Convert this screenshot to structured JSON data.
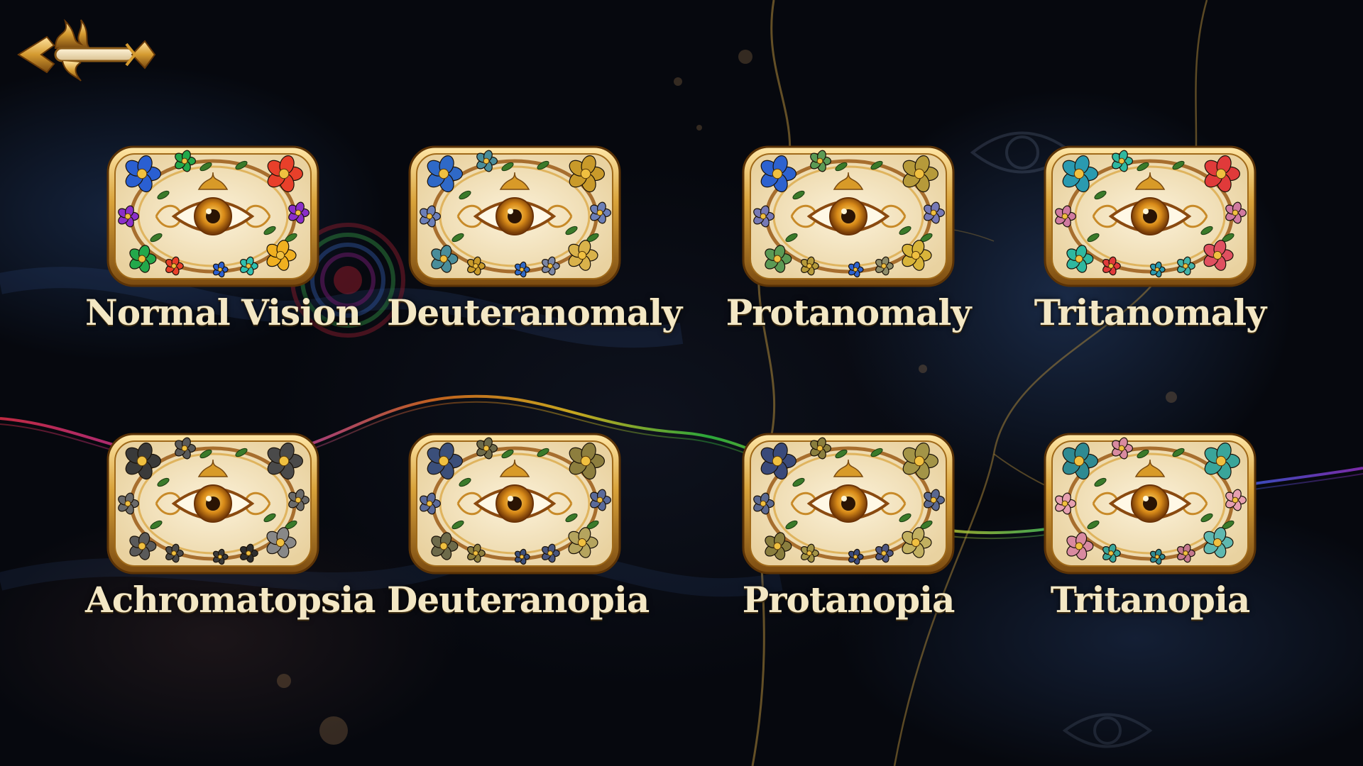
{
  "screen": {
    "title": "",
    "back_button": {
      "icon": "ornate-back-arrow-icon"
    }
  },
  "vision_modes": [
    {
      "id": "normal-vision",
      "label": "Normal Vision",
      "flower_colors": [
        "#2a5fd1",
        "#23a84b",
        "#e8402a",
        "#8b2fc9",
        "#f0b020",
        "#2fc0b0"
      ]
    },
    {
      "id": "deuteranomaly",
      "label": "Deuteranomaly",
      "flower_colors": [
        "#2f69c7",
        "#4a8d9a",
        "#c99a2a",
        "#6c7fb8",
        "#d9b24a",
        "#7b86a4"
      ]
    },
    {
      "id": "protanomaly",
      "label": "Protanomaly",
      "flower_colors": [
        "#2d62cf",
        "#5b9a55",
        "#b69a3a",
        "#7679b6",
        "#d8b43a",
        "#8e8c6a"
      ]
    },
    {
      "id": "tritanomaly",
      "label": "Tritanomaly",
      "flower_colors": [
        "#2a9ab0",
        "#2fb8a0",
        "#e03a3a",
        "#d07aa0",
        "#e05060",
        "#43b3a8"
      ]
    },
    {
      "id": "achromatopsia",
      "label": "Achromatopsia",
      "flower_colors": [
        "#3a3a3a",
        "#5a5a5a",
        "#4a4a4a",
        "#6a6a6a",
        "#888888",
        "#2e2e2e"
      ]
    },
    {
      "id": "deuteranopia",
      "label": "Deuteranopia",
      "flower_colors": [
        "#3b4f7a",
        "#6d6a4a",
        "#8d7e3e",
        "#5a6a9a",
        "#b5a45e",
        "#49567e"
      ]
    },
    {
      "id": "protanopia",
      "label": "Protanopia",
      "flower_colors": [
        "#3a4a7a",
        "#8a7e3e",
        "#a39447",
        "#5a6890",
        "#c2b060",
        "#4d5680"
      ]
    },
    {
      "id": "tritanopia",
      "label": "Tritanopia",
      "flower_colors": [
        "#2f8a92",
        "#d98aa0",
        "#3aa59a",
        "#e6a0b0",
        "#5fb8b0",
        "#c4788e"
      ]
    }
  ],
  "colors": {
    "label_text": "#f3e7c4",
    "gold": "#d8a23a",
    "gold_dark": "#8a5a18",
    "card_inner": "#f4e6c6",
    "background": "#06080e"
  }
}
